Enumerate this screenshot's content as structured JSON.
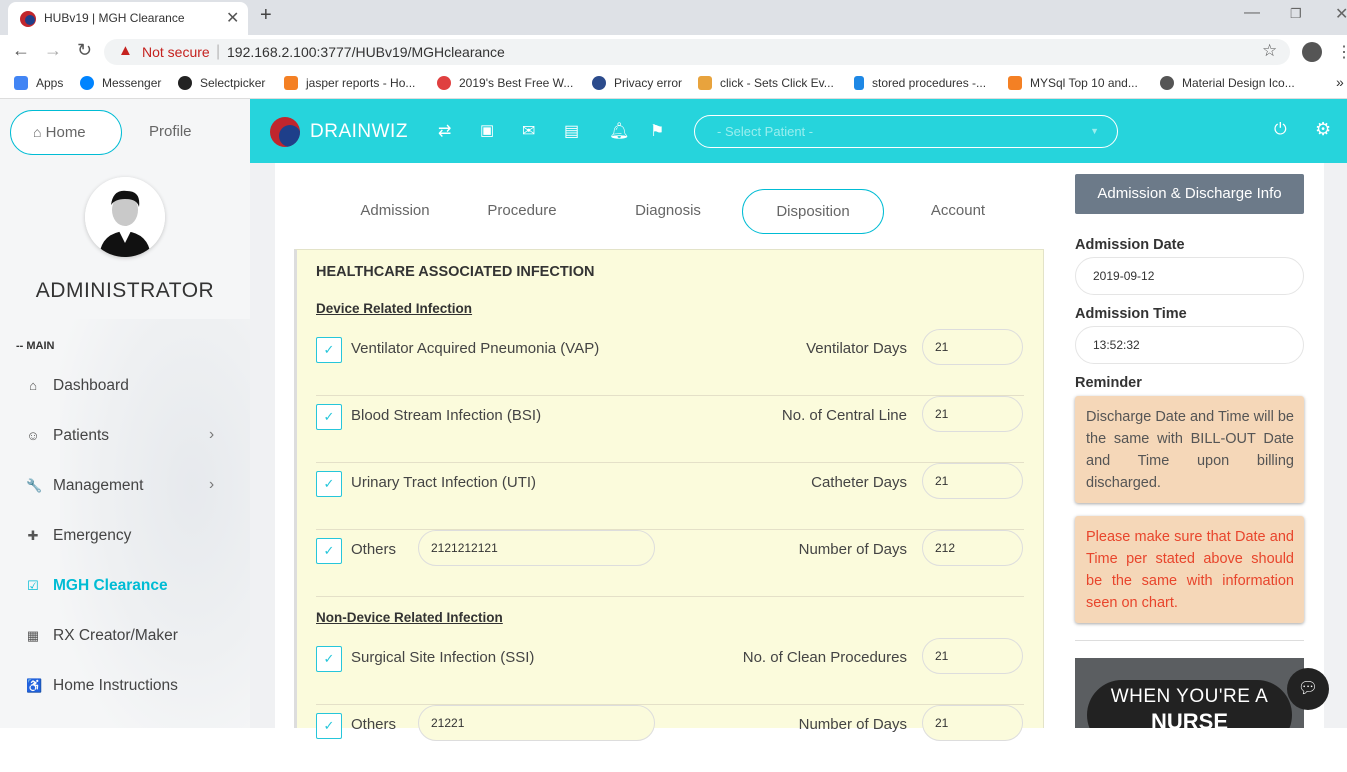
{
  "browser": {
    "tab_title": "HUBv19 | MGH Clearance",
    "tab_close": "✕",
    "new_tab": "+",
    "not_secure": "Not secure",
    "url": "192.168.2.100:3777/HUBv19/MGHclearance",
    "bookmarks": [
      {
        "label": "Apps",
        "color": "#4285f4"
      },
      {
        "label": "Messenger",
        "color": "#0084ff"
      },
      {
        "label": "Selectpicker",
        "color": "#222222"
      },
      {
        "label": "jasper reports - Ho...",
        "color": "#f48024"
      },
      {
        "label": "2019's Best Free W...",
        "color": "#e04040"
      },
      {
        "label": "Privacy error",
        "color": "#2b4b8c"
      },
      {
        "label": "click - Sets Click Ev...",
        "color": "#e8a33d"
      },
      {
        "label": "stored procedures -...",
        "color": "#1e88e5"
      },
      {
        "label": "MYSql Top 10 and...",
        "color": "#f48024"
      },
      {
        "label": "Material Design Ico...",
        "color": "#555555"
      }
    ]
  },
  "sidebar": {
    "home_label": "Home",
    "profile_label": "Profile",
    "user_name": "ADMINISTRATOR",
    "section_label": "-- MAIN",
    "items": [
      {
        "label": "Dashboard",
        "icon": "⌂",
        "has_arrow": false
      },
      {
        "label": "Patients",
        "icon": "☺",
        "has_arrow": true
      },
      {
        "label": "Management",
        "icon": "🔧",
        "has_arrow": true
      },
      {
        "label": "Emergency",
        "icon": "✚",
        "has_arrow": false
      },
      {
        "label": "MGH Clearance",
        "icon": "☑",
        "has_arrow": false,
        "active": true
      },
      {
        "label": "RX Creator/Maker",
        "icon": "▦",
        "has_arrow": false
      },
      {
        "label": "Home Instructions",
        "icon": "♿",
        "has_arrow": false
      }
    ],
    "arrow": "›"
  },
  "header": {
    "brand": "DRAINWIZ",
    "patient_placeholder": "- Select Patient -",
    "accent": "#26d4dc"
  },
  "tabs": [
    "Admission",
    "Procedure",
    "Diagnosis",
    "Disposition",
    "Account"
  ],
  "active_tab": "Disposition",
  "infection": {
    "title": "HEALTHCARE ASSOCIATED INFECTION",
    "device_heading": "Device Related Infection",
    "non_device_heading": "Non-Device Related Infection",
    "device_rows": [
      {
        "label": "Ventilator Acquired Pneumonia (VAP)",
        "right_label": "Ventilator Days",
        "value": "21",
        "checked": true
      },
      {
        "label": "Blood Stream Infection (BSI)",
        "right_label": "No. of Central Line",
        "value": "21",
        "checked": true
      },
      {
        "label": "Urinary Tract Infection (UTI)",
        "right_label": "Catheter Days",
        "value": "21",
        "checked": true
      },
      {
        "label": "Others",
        "text_value": "2121212121",
        "right_label": "Number of Days",
        "value": "212",
        "checked": true
      }
    ],
    "non_device_rows": [
      {
        "label": "Surgical Site Infection (SSI)",
        "right_label": "No. of Clean Procedures",
        "value": "21",
        "checked": true
      },
      {
        "label": "Others",
        "text_value": "21221",
        "right_label": "Number of Days",
        "value": "21",
        "checked": true
      }
    ],
    "check_mark": "✓"
  },
  "right_panel": {
    "button_label": "Admission & Discharge Info",
    "admission_date_label": "Admission Date",
    "admission_date": "2019-09-12",
    "admission_time_label": "Admission Time",
    "admission_time": "13:52:32",
    "reminder_label": "Reminder",
    "reminder_1": "Discharge Date and Time will be the same with BILL-OUT Date and Time upon billing discharged.",
    "reminder_2": "Please make sure that Date and Time per stated above should be the same with information seen on chart.",
    "reminder_1_color": "#555555",
    "reminder_2_color": "#e8452c",
    "image_line1": "WHEN YOU'RE A",
    "image_line2": "NURSE"
  }
}
